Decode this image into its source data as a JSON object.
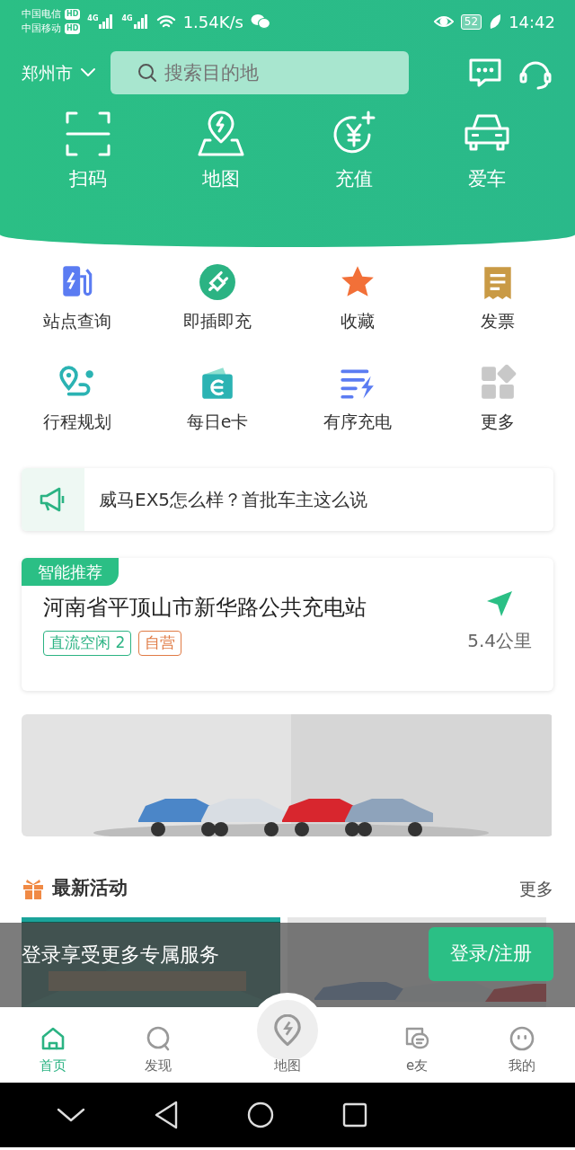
{
  "status_bar": {
    "carriers": [
      {
        "name": "中国电信",
        "badge": "HD"
      },
      {
        "name": "中国移动",
        "badge": "HD"
      }
    ],
    "networks": [
      "4G",
      "4G"
    ],
    "speed": "1.54K/s",
    "battery": "52",
    "time": "14:42"
  },
  "header": {
    "city": "郑州市",
    "search": {
      "placeholder": "搜索目的地"
    }
  },
  "quick_actions": [
    {
      "label": "扫码",
      "kind": "scan"
    },
    {
      "label": "地图",
      "kind": "map"
    },
    {
      "label": "充值",
      "kind": "topup"
    },
    {
      "label": "爱车",
      "kind": "car"
    }
  ],
  "services": [
    {
      "label": "站点查询",
      "kind": "station"
    },
    {
      "label": "即插即充",
      "kind": "plug"
    },
    {
      "label": "收藏",
      "kind": "star"
    },
    {
      "label": "发票",
      "kind": "invoice"
    },
    {
      "label": "行程规划",
      "kind": "route"
    },
    {
      "label": "每日e卡",
      "kind": "ecard"
    },
    {
      "label": "有序充电",
      "kind": "ordered"
    },
    {
      "label": "更多",
      "kind": "more"
    }
  ],
  "notice": {
    "text": "威马EX5怎么样？首批车主这么说"
  },
  "recommend": {
    "tag": "智能推荐",
    "name": "河南省平顶山市新华路公共充电站",
    "tags": [
      {
        "text": "直流空闲 2",
        "color": "#2bb383"
      },
      {
        "text": "自营",
        "color": "#e07b45"
      }
    ],
    "distance": "5.4公里"
  },
  "activities": {
    "title": "最新活动",
    "more": "更多"
  },
  "login_bar": {
    "text": "登录享受更多专属服务",
    "button": "登录/注册"
  },
  "tabs": [
    {
      "label": "首页",
      "kind": "home",
      "selected": true
    },
    {
      "label": "发现",
      "kind": "discover",
      "selected": false
    },
    {
      "label": "地图",
      "kind": "map",
      "selected": false
    },
    {
      "label": "e友",
      "kind": "friends",
      "selected": false
    },
    {
      "label": "我的",
      "kind": "me",
      "selected": false
    }
  ]
}
